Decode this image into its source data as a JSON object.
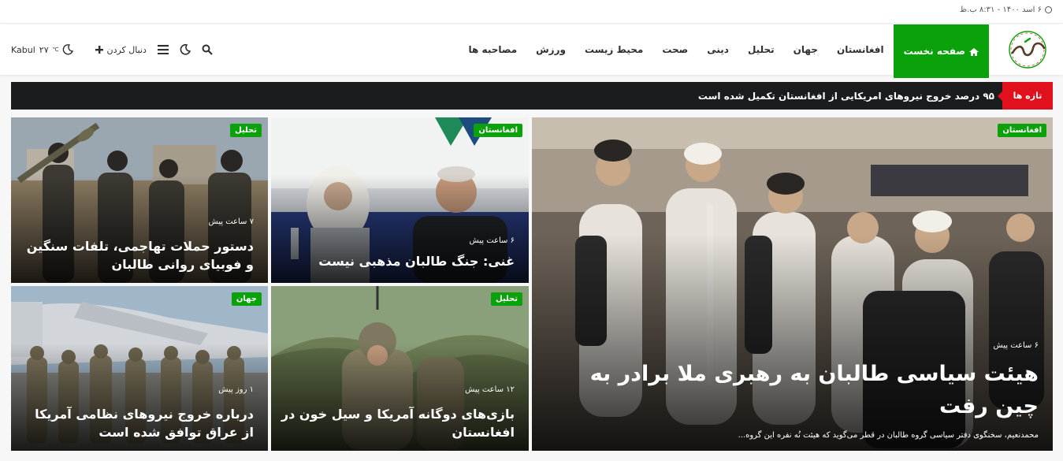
{
  "topbar": {
    "date": "۶ اسد ۱۴۰۰ - ۸:۳۱ ب.ظ"
  },
  "header": {
    "nav": [
      "صفحه نخست",
      "افغانستان",
      "جهان",
      "تحلیل",
      "دینی",
      "صحت",
      "محیط زیست",
      "ورزش",
      "مصاحبه ها"
    ],
    "weather_city": "Kabul",
    "weather_temp": "۲۷",
    "weather_unit": "℃",
    "follow_label": "دنبال کردن"
  },
  "breaking": {
    "tag": "تازه ها",
    "text": "۹۵ درصد خروج نیروهای امریکایی از افغانستان تکمیل شده است"
  },
  "featured": {
    "category": "افغانستان",
    "time": "۶ ساعت پیش",
    "title": "هیئت سیاسی طالبان به رهبری ملا برادر به چین رفت",
    "excerpt": "محمدنعیم، سخنگوی دفتر سیاسی گروه طالبان در قطر می‌گوید که هیئت نُه نفره این گروه..."
  },
  "posts": [
    {
      "category": "افغانستان",
      "time": "۶ ساعت پیش",
      "title": "غنی: جنگ طالبان مذهبی نیست"
    },
    {
      "category": "تحلیل",
      "time": "۷ ساعت پیش",
      "title": "دستور حملات تهاجمی، تلفات سنگین و فوبیای روانی طالبان"
    },
    {
      "category": "تحلیل",
      "time": "۱۲ ساعت پیش",
      "title": "بازی‌های دوگانه آمریکا و سیل خون در افغانستان"
    },
    {
      "category": "جهان",
      "time": "۱ روز پیش",
      "title": "درباره خروج نیروهای نظامی آمریکا از عراق توافق شده است"
    }
  ],
  "colors": {
    "accent": "#0aa10a",
    "breaking": "#e1101d",
    "dark": "#1b1c1e"
  }
}
